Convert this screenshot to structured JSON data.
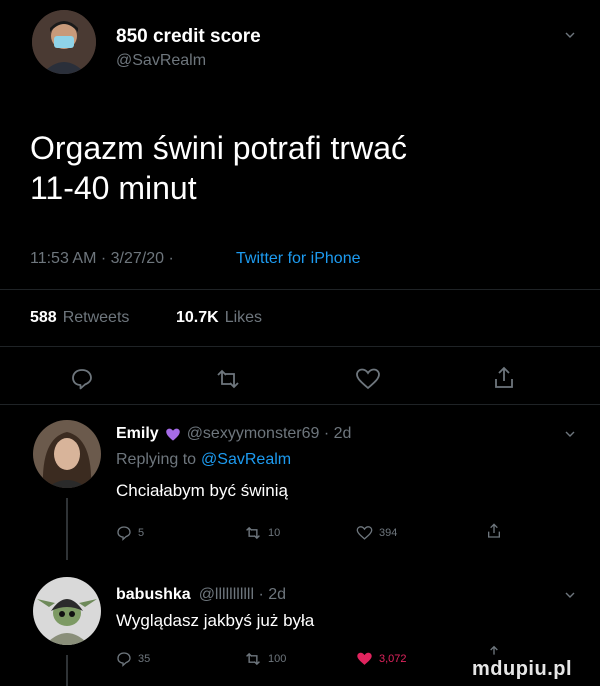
{
  "main_tweet": {
    "author_name": "850 credit score",
    "handle": "@SavRealm",
    "text_line1": "Orgazm świni potrafi trwać",
    "text_line2": "11-40 minut",
    "meta_time": "11:53 AM · 3/27/20 ·",
    "meta_source": "Twitter for iPhone",
    "retweets_count": "588",
    "retweets_label": "Retweets",
    "likes_count": "10.7K",
    "likes_label": "Likes"
  },
  "replies": [
    {
      "author_name": "Emily",
      "handle_time": "@sexyymonster69 · 2d",
      "replying_prefix": "Replying to",
      "replying_handle": "@SavRealm",
      "text": "Chciałabym być świnią",
      "replies_count": "5",
      "retweets_count": "10",
      "likes_count": "394"
    },
    {
      "author_name": "babushka",
      "handle_time": "@lllllllllll · 2d",
      "text": "Wyglądasz jakbyś już była",
      "replies_count": "35",
      "retweets_count": "100",
      "likes_count": "3,072"
    }
  ],
  "watermark": "mdupiu.pl",
  "icons": [
    "reply-icon",
    "retweet-icon",
    "like-icon",
    "share-icon",
    "chevron-down-icon",
    "purple-heart-emoji"
  ],
  "colors": {
    "background": "#000000",
    "muted": "#6e767d",
    "accent": "#1d9bf0",
    "like": "#e0245e",
    "heart_emoji": "#a66ce8"
  }
}
